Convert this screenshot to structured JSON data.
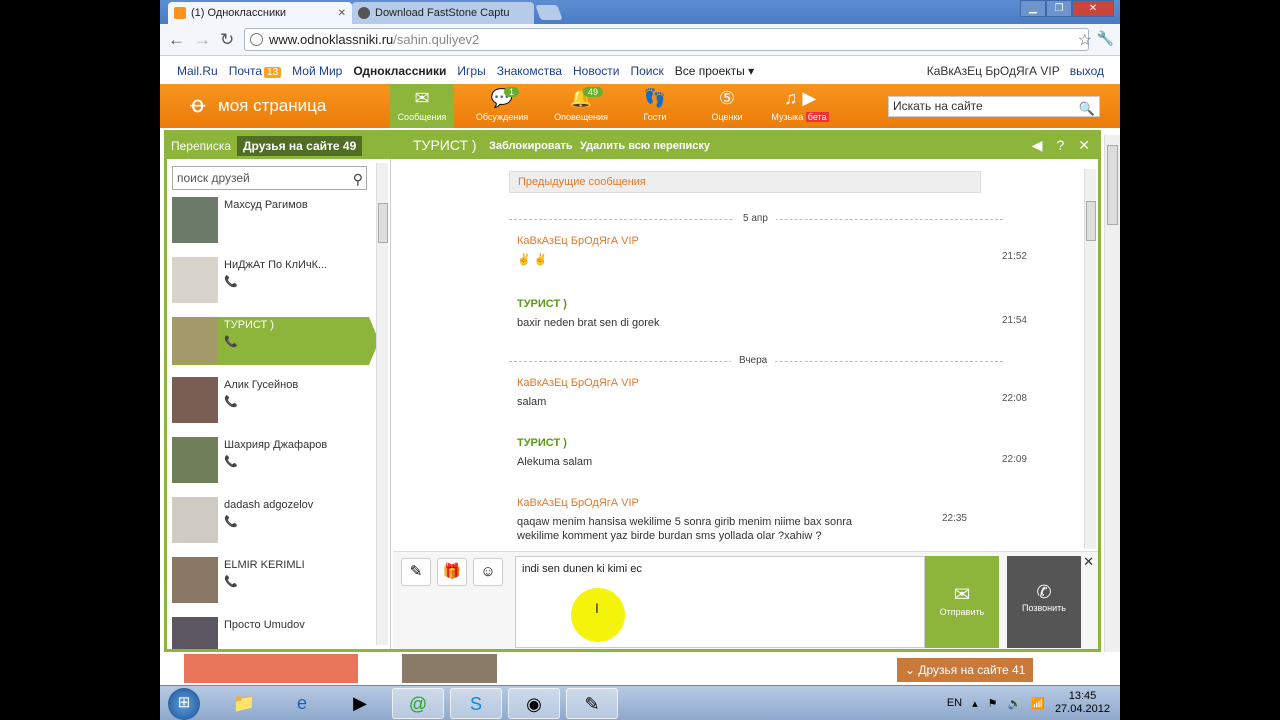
{
  "browser": {
    "tabs": [
      {
        "label": "(1) Одноклассники",
        "active": true
      },
      {
        "label": "Download FastStone Captu",
        "active": false
      }
    ],
    "url_host": "www.odnoklassniki.ru",
    "url_path": "/sahin.quliyev2"
  },
  "mailbar": {
    "links": [
      "Mail.Ru",
      "Почта",
      "Мой Мир",
      "Одноклассники",
      "Игры",
      "Знакомства",
      "Новости",
      "Поиск",
      "Все проекты ▾"
    ],
    "mail_count": "13",
    "user": "КаВкАзЕц БрОдЯгА VIP",
    "logout": "выход"
  },
  "okbar": {
    "title": "моя страница",
    "nav": [
      {
        "label": "Сообщения",
        "icon": "envelope-icon",
        "count": ""
      },
      {
        "label": "Обсуждения",
        "icon": "speech-bubbles-icon",
        "count": "1"
      },
      {
        "label": "Оповещения",
        "icon": "bell-icon",
        "count": "49"
      },
      {
        "label": "Гости",
        "icon": "footprints-icon",
        "count": ""
      },
      {
        "label": "Оценки",
        "icon": "five-icon",
        "count": ""
      },
      {
        "label": "Музыка",
        "icon": "music-icon",
        "count": ""
      }
    ],
    "music_badge": "бета",
    "search_placeholder": "Искать на сайте"
  },
  "messenger": {
    "tab_correspondence": "Переписка",
    "tab_friends": "Друзья на сайте 49",
    "chat_name": "ТУРИСТ )",
    "block": "Заблокировать",
    "delete_all": "Удалить всю переписку",
    "friend_search_placeholder": "поиск друзей",
    "friends": [
      {
        "name": "Махсуд Рагимов",
        "phone": false
      },
      {
        "name": "НиДжАт По КлИчК...",
        "phone": true
      },
      {
        "name": "ТУРИСТ )",
        "phone": true,
        "selected": true
      },
      {
        "name": "Алик Гусейнов",
        "phone": true
      },
      {
        "name": "Шахрияр Джафаров",
        "phone": true
      },
      {
        "name": "dadash adgozelov",
        "phone": true
      },
      {
        "name": "ELMIR KERIMLI",
        "phone": true
      },
      {
        "name": "Просто Umudov",
        "phone": true
      }
    ],
    "previous_messages": "Предыдущие сообщения",
    "date_1": "5 апр",
    "date_2": "Вчера",
    "messages": [
      {
        "author": "КаВкАзЕц БрОдЯгА VIP",
        "text": "✌ ✌",
        "time": "21:52",
        "me": true
      },
      {
        "author": "ТУРИСТ )",
        "text": "baxir neden brat sen di gorek",
        "time": "21:54",
        "me": false
      },
      {
        "author": "КаВкАзЕц БрОдЯгА VIP",
        "text": "salam",
        "time": "22:08",
        "me": true
      },
      {
        "author": "ТУРИСТ )",
        "text": "Alekuma salam",
        "time": "22:09",
        "me": false
      },
      {
        "author": "КаВкАзЕц БрОдЯгА VIP",
        "text": "qaqaw menim hansisa wekilime 5 sonra girib menim niime bax sonra wekilime komment yaz birde burdan sms yollada olar ?xahiw ?",
        "time": "22:35",
        "me": true
      }
    ],
    "compose_text": "indi sen dunen ki kimi ec",
    "send_label": "Отправить",
    "call_label": "Позвонить"
  },
  "footer": {
    "friends_online": "Друзья на сайте 41"
  },
  "taskbar": {
    "lang": "EN",
    "time": "13:45",
    "date": "27.04.2012"
  }
}
